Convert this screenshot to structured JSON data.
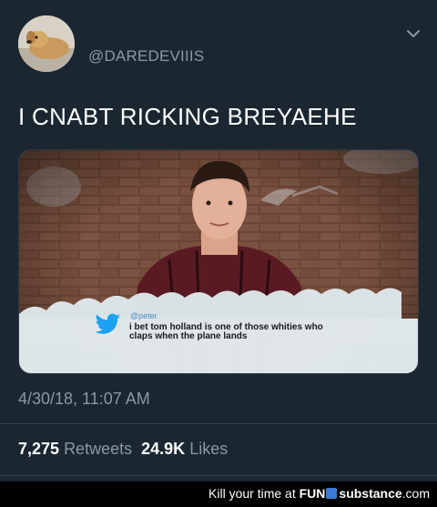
{
  "tweet": {
    "handle": "@DAREDEVIIIS",
    "text": "I CNABT RICKING BREYAEHE",
    "timestamp": "4/30/18, 11:07 AM",
    "retweets_count": "7,275",
    "retweets_label": "Retweets",
    "likes_count": "24.9K",
    "likes_label": "Likes"
  },
  "media": {
    "meme_user": "@peter",
    "meme_text": "i bet tom holland is one of those whities who claps when the plane lands"
  },
  "footer": {
    "tagline": "Kill your time at",
    "brand_fun": "FUN",
    "brand_rest": "substance",
    "brand_tld": ".com"
  },
  "colors": {
    "background": "#1b2631",
    "muted": "#8899a6",
    "twitter_blue": "#1da1f2"
  }
}
